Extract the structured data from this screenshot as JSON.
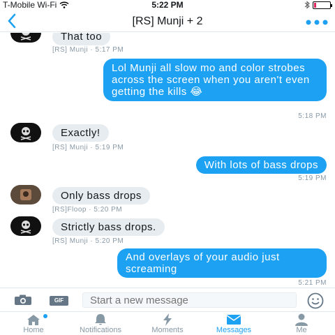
{
  "status": {
    "carrier": "T-Mobile Wi-Fi",
    "time": "5:22 PM",
    "battery_level": 0.15,
    "battery_color": "#e0245e"
  },
  "nav": {
    "back_icon": "chevron-left-icon",
    "title": "[RS] Munji + 2",
    "more_icon": "ellipsis-icon"
  },
  "messages": [
    {
      "side": "in",
      "avatar": "skull",
      "text": "That too",
      "meta": "[RS] Munji · 5:17 PM"
    },
    {
      "side": "out",
      "text": "Lol Munji all slow mo and color strobes across the screen when you aren't even getting the kills 😂",
      "meta": "5:18 PM"
    },
    {
      "side": "in",
      "avatar": "skull",
      "text": "Exactly!",
      "meta": "[RS] Munji · 5:19 PM"
    },
    {
      "side": "out",
      "text": "With lots of bass drops",
      "meta": "5:19 PM"
    },
    {
      "side": "in",
      "avatar": "floop",
      "text": "Only bass drops",
      "meta": "[RS]Floop · 5:20 PM"
    },
    {
      "side": "in",
      "avatar": "skull",
      "text": "Strictly bass drops.",
      "meta": "[RS] Munji · 5:20 PM"
    },
    {
      "side": "out",
      "text": "And overlays of your audio just screaming",
      "meta": "5:21 PM"
    }
  ],
  "composer": {
    "camera_icon": "camera-icon",
    "gif_label": "GIF",
    "placeholder": "Start a new message",
    "emoji_icon": "smiley-icon"
  },
  "tabs": [
    {
      "label": "Home",
      "icon": "home-icon",
      "active": false,
      "badge": true
    },
    {
      "label": "Notifications",
      "icon": "bell-icon",
      "active": false
    },
    {
      "label": "Moments",
      "icon": "lightning-icon",
      "active": false
    },
    {
      "label": "Messages",
      "icon": "envelope-icon",
      "active": true
    },
    {
      "label": "Me",
      "icon": "person-icon",
      "active": false
    }
  ],
  "colors": {
    "accent": "#1da1f2",
    "incoming_bubble": "#e6ecf0",
    "meta_text": "#8899a6"
  }
}
